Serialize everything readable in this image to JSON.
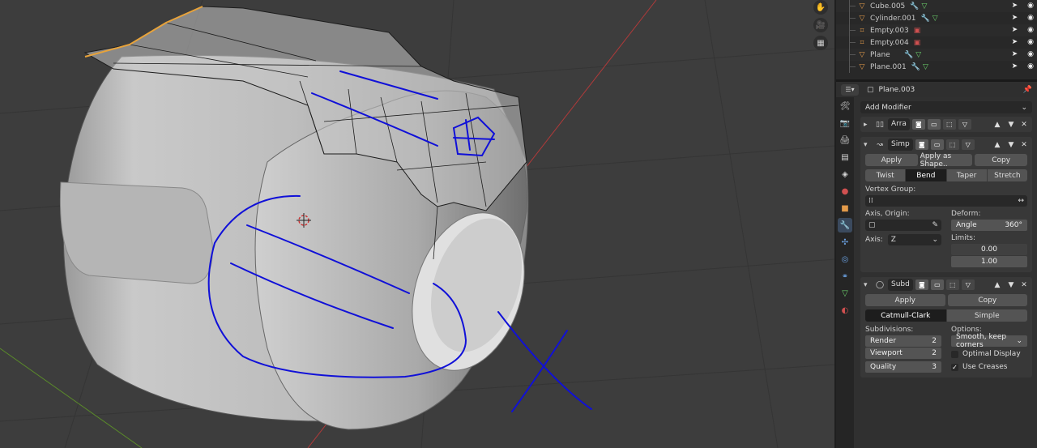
{
  "outliner": {
    "items": [
      {
        "name": "Cube.005",
        "icon": "mesh-triangle-icon",
        "mods": [
          "wrench-icon",
          "mesh-data-icon"
        ]
      },
      {
        "name": "Cylinder.001",
        "icon": "mesh-triangle-icon",
        "mods": [
          "wrench-icon",
          "mesh-data-icon"
        ]
      },
      {
        "name": "Empty.003",
        "icon": "empty-icon",
        "mods": [
          "image-icon"
        ]
      },
      {
        "name": "Empty.004",
        "icon": "empty-icon",
        "mods": [
          "image-icon"
        ]
      },
      {
        "name": "Plane",
        "icon": "mesh-triangle-icon",
        "mods": [
          "wrench-icon",
          "mesh-data-icon"
        ]
      },
      {
        "name": "Plane.001",
        "icon": "mesh-triangle-icon",
        "mods": [
          "wrench-icon",
          "mesh-data-icon"
        ]
      }
    ]
  },
  "properties": {
    "object_name": "Plane.003",
    "add_modifier": "Add Modifier",
    "array_modifier": {
      "name": "Arra"
    },
    "simple_deform": {
      "name": "Simp",
      "apply": "Apply",
      "apply_as_shape": "Apply as Shape..",
      "copy": "Copy",
      "modes": [
        "Twist",
        "Bend",
        "Taper",
        "Stretch"
      ],
      "active_mode": "Bend",
      "vertex_group_label": "Vertex Group:",
      "axis_origin_label": "Axis, Origin:",
      "deform_label": "Deform:",
      "angle_label": "Angle",
      "angle_value": "360°",
      "axis_label": "Axis:",
      "axis_value": "Z",
      "limits_label": "Limits:",
      "limit_min": "0.00",
      "limit_max": "1.00"
    },
    "subsurf": {
      "name": "Subd",
      "apply": "Apply",
      "copy": "Copy",
      "types": [
        "Catmull-Clark",
        "Simple"
      ],
      "active_type": "Catmull-Clark",
      "subdivisions_label": "Subdivisions:",
      "options_label": "Options:",
      "render_label": "Render",
      "render_value": "2",
      "viewport_label": "Viewport",
      "viewport_value": "2",
      "quality_label": "Quality",
      "quality_value": "3",
      "uv_smooth": "Smooth, keep corners",
      "optimal_display": "Optimal Display",
      "optimal_display_checked": false,
      "use_creases": "Use Creases",
      "use_creases_checked": true
    }
  },
  "colors": {
    "viewport_bg": "#3d3d3d",
    "annotation": "#1010d8",
    "x_axis": "#b03a3a",
    "y_axis": "#5a8a2a",
    "selection": "#e8a33a"
  }
}
